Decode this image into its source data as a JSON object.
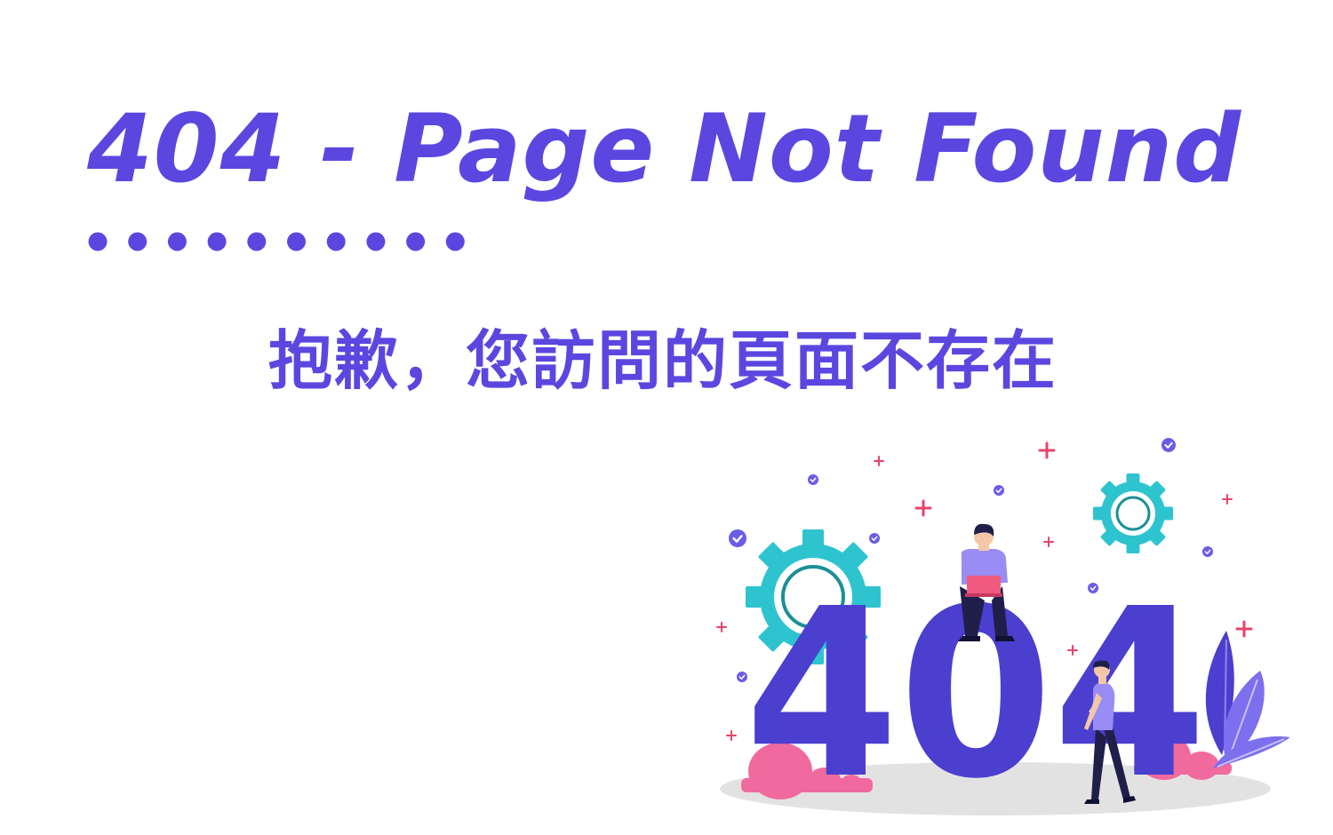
{
  "page": {
    "title": "404 - Page Not Found",
    "subtitle": "抱歉，您訪問的頁面不存在"
  },
  "illustration": {
    "big_text": "404",
    "icons": [
      "gear-icon",
      "check-circle-icon",
      "plus-icon",
      "leaf-plant-icon",
      "bush-icon"
    ]
  },
  "colors": {
    "primary": "#5b47e0",
    "dark_blue": "#4a3fcf",
    "teal": "#2ec4cf",
    "pink": "#f06a9e",
    "plus_red": "#e8436a",
    "ground": "#e2e2e2",
    "person_shirt": "#9a8cf5",
    "person_pants": "#1f1f4a",
    "laptop": "#f05a7e"
  }
}
